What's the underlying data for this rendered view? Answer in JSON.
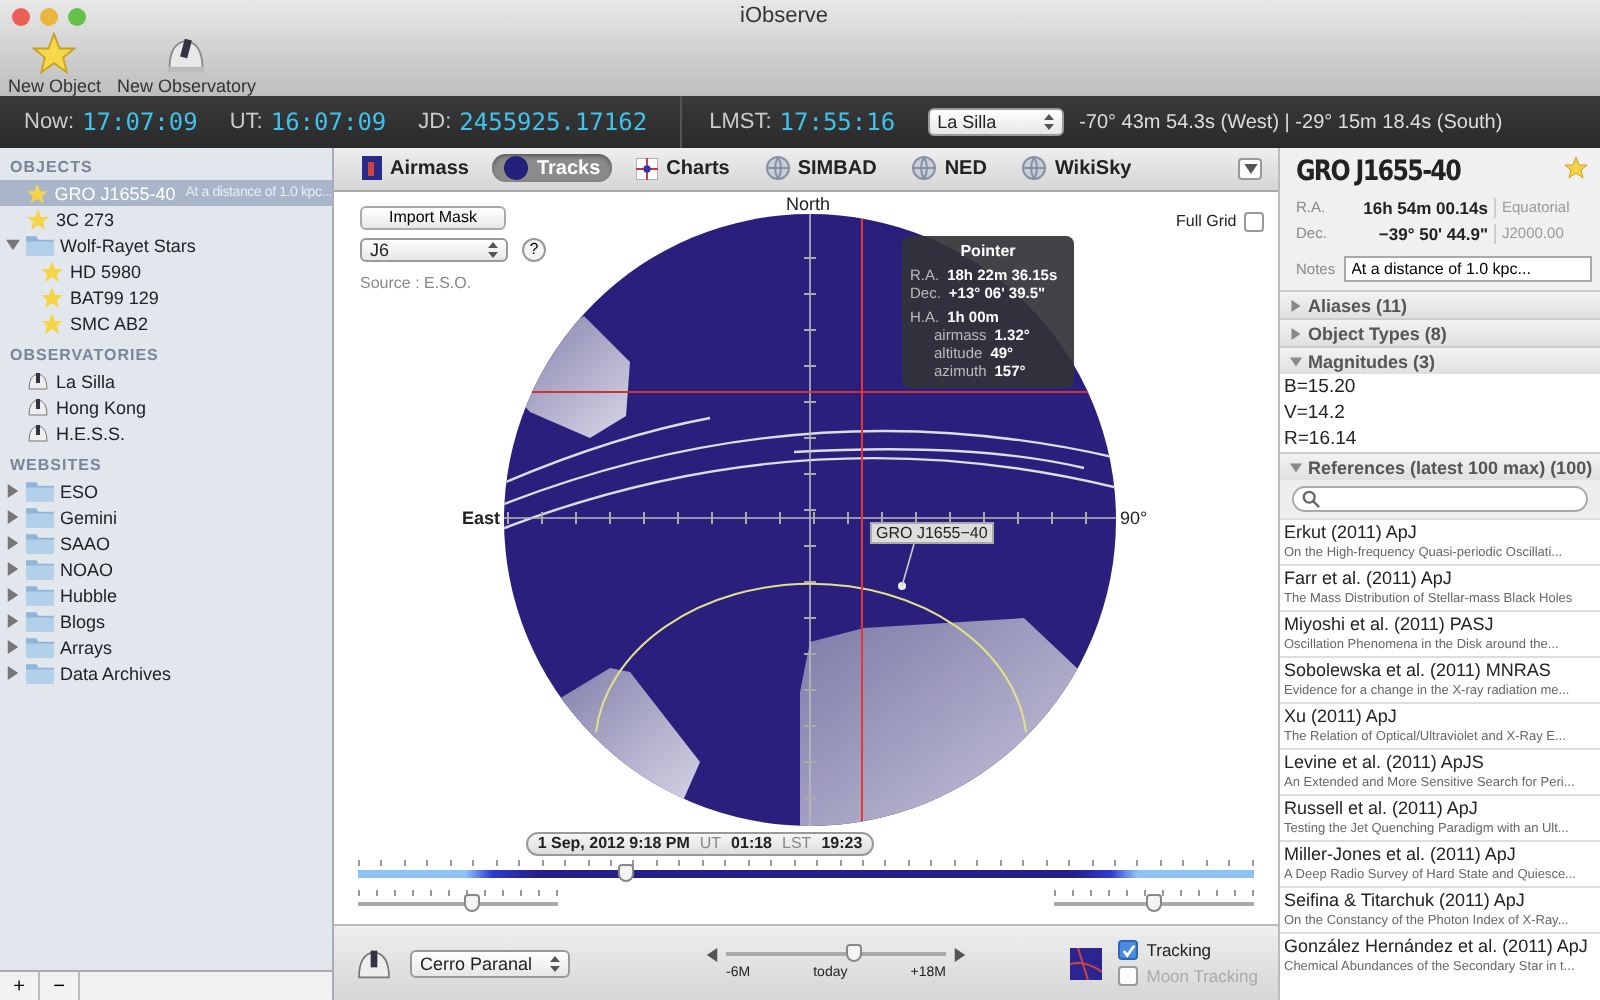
{
  "window": {
    "title": "iObserve"
  },
  "toolbar": {
    "buttons": [
      {
        "label": "New Object",
        "kind": "star"
      },
      {
        "label": "New Observatory",
        "kind": "observatory"
      }
    ]
  },
  "clock_bar": {
    "now_label": "Now:",
    "now": "17:07:09",
    "ut_label": "UT:",
    "ut": "16:07:09",
    "jd_label": "JD:",
    "jd": "2455925.17162",
    "lmst_label": "LMST:",
    "lmst": "17:55:16",
    "site": "La Silla",
    "coordinates": "-70° 43m 54.3s (West) | -29° 15m 18.4s (South)"
  },
  "sidebar": {
    "sections": [
      {
        "title": "OBJECTS",
        "items": [
          {
            "kind": "object",
            "label": "GRO J1655-40",
            "note": "At a distance of 1.0 kpc...",
            "selected": true
          },
          {
            "kind": "object",
            "label": "3C 273",
            "selected": false
          },
          {
            "kind": "folder",
            "label": "Wolf-Rayet Stars",
            "selected": false,
            "expanded": true,
            "children": [
              {
                "kind": "object",
                "label": "HD 5980",
                "selected": false
              },
              {
                "kind": "object",
                "label": "BAT99 129",
                "selected": false
              },
              {
                "kind": "object",
                "label": "SMC AB2",
                "selected": false
              }
            ]
          }
        ]
      },
      {
        "title": "OBSERVATORIES",
        "items": [
          {
            "kind": "observatory",
            "label": "La Silla",
            "selected": false
          },
          {
            "kind": "observatory",
            "label": "Hong Kong",
            "selected": false
          },
          {
            "kind": "observatory",
            "label": "H.E.S.S.",
            "selected": false
          }
        ]
      },
      {
        "title": "WEBSITES",
        "items": [
          {
            "kind": "folder",
            "label": "ESO",
            "selected": false,
            "expanded": false
          },
          {
            "kind": "folder",
            "label": "Gemini",
            "selected": false,
            "expanded": false
          },
          {
            "kind": "folder",
            "label": "SAAO",
            "selected": false,
            "expanded": false
          },
          {
            "kind": "folder",
            "label": "NOAO",
            "selected": false,
            "expanded": false
          },
          {
            "kind": "folder",
            "label": "Hubble",
            "selected": false,
            "expanded": false
          },
          {
            "kind": "folder",
            "label": "Blogs",
            "selected": false,
            "expanded": false
          },
          {
            "kind": "folder",
            "label": "Arrays",
            "selected": false,
            "expanded": false
          },
          {
            "kind": "folder",
            "label": "Data Archives",
            "selected": false,
            "expanded": false
          }
        ]
      }
    ],
    "footer_buttons": [
      "+",
      "−"
    ]
  },
  "tabs": [
    {
      "label": "Airmass",
      "selected": false,
      "kind": "airmass"
    },
    {
      "label": "Tracks",
      "selected": true,
      "kind": "tracks"
    },
    {
      "label": "Charts",
      "selected": false,
      "kind": "charts"
    },
    {
      "label": "SIMBAD",
      "selected": false,
      "kind": "globe"
    },
    {
      "label": "NED",
      "selected": false,
      "kind": "globe"
    },
    {
      "label": "WikiSky",
      "selected": false,
      "kind": "globe"
    }
  ],
  "sky_view": {
    "import_button": "Import Mask",
    "mask": "J6",
    "help": "?",
    "source": "Source : E.S.O.",
    "full_grid": {
      "label": "Full Grid",
      "checked": false
    },
    "north": "North",
    "east": "East",
    "right_angle": "90°",
    "pointer": {
      "title": "Pointer",
      "rows": [
        {
          "label": "R.A.",
          "value": "18h 22m 36.15s"
        },
        {
          "label": "Dec.",
          "value": "+13° 06' 39.5\""
        },
        {
          "label": "H.A.",
          "value": "1h 00m"
        },
        {
          "label": "airmass",
          "value": "1.32°"
        },
        {
          "label": "altitude",
          "value": "49°"
        },
        {
          "label": "azimuth",
          "value": "157°"
        }
      ]
    },
    "object_label": "GRO J1655−40",
    "date": {
      "date": "1 Sep, 2012 9:18 PM",
      "ut_label": "UT",
      "ut": "01:18",
      "lst_label": "LST",
      "lst": "19:23"
    },
    "timeline": {
      "level": 0.3
    },
    "left_slider": {
      "level": 0.57
    },
    "right_slider": {
      "level": 0.5
    }
  },
  "bottom_bar": {
    "observatory": "Cerro Paranal",
    "range": {
      "min": "-6M",
      "mid": "today",
      "max": "+18M",
      "level": 0.58
    },
    "tracking": {
      "label": "Tracking",
      "checked": true
    },
    "moon_tracking": {
      "label": "Moon Tracking",
      "checked": false,
      "disabled": true
    }
  },
  "details": {
    "title": "GRO J1655-40",
    "ra_label": "R.A.",
    "ra": "16h 54m 00.14s",
    "dec_label": "Dec.",
    "dec": "−39° 50' 44.9\"",
    "frame": "Equatorial",
    "epoch": "J2000.00",
    "notes_label": "Notes",
    "notes": "At a distance of 1.0 kpc...",
    "sections": [
      {
        "title": "Aliases (11)",
        "expanded": false
      },
      {
        "title": "Object Types (8)",
        "expanded": false
      },
      {
        "title": "Magnitudes (3)",
        "expanded": true,
        "items": [
          "B=15.20",
          "V=14.2",
          "R=16.14"
        ]
      }
    ],
    "references": {
      "title": "References (latest 100 max) (100)",
      "expanded": true,
      "items": [
        {
          "title": "Erkut (2011) ApJ",
          "subtitle": "On the High-frequency Quasi-periodic Oscillati..."
        },
        {
          "title": "Farr et al. (2011) ApJ",
          "subtitle": "The Mass Distribution of Stellar-mass Black Holes"
        },
        {
          "title": "Miyoshi et al. (2011) PASJ",
          "subtitle": "Oscillation Phenomena in the Disk around the..."
        },
        {
          "title": "Sobolewska et al. (2011) MNRAS",
          "subtitle": "Evidence for a change in the X-ray radiation me..."
        },
        {
          "title": "Xu (2011) ApJ",
          "subtitle": "The Relation of Optical/Ultraviolet and X-Ray E..."
        },
        {
          "title": "Levine et al. (2011) ApJS",
          "subtitle": "An Extended and More Sensitive Search for Peri..."
        },
        {
          "title": "Russell et al. (2011) ApJ",
          "subtitle": "Testing the Jet Quenching Paradigm with an Ult..."
        },
        {
          "title": "Miller-Jones et al. (2011) ApJ",
          "subtitle": "A Deep Radio Survey of Hard State and Quiesce..."
        },
        {
          "title": "Seifina & Titarchuk (2011) ApJ",
          "subtitle": "On the Constancy of the Photon Index of X-Ray..."
        },
        {
          "title": "González Hernández et al. (2011) ApJ",
          "subtitle": "Chemical Abundances of the Secondary Star in t..."
        }
      ]
    }
  }
}
